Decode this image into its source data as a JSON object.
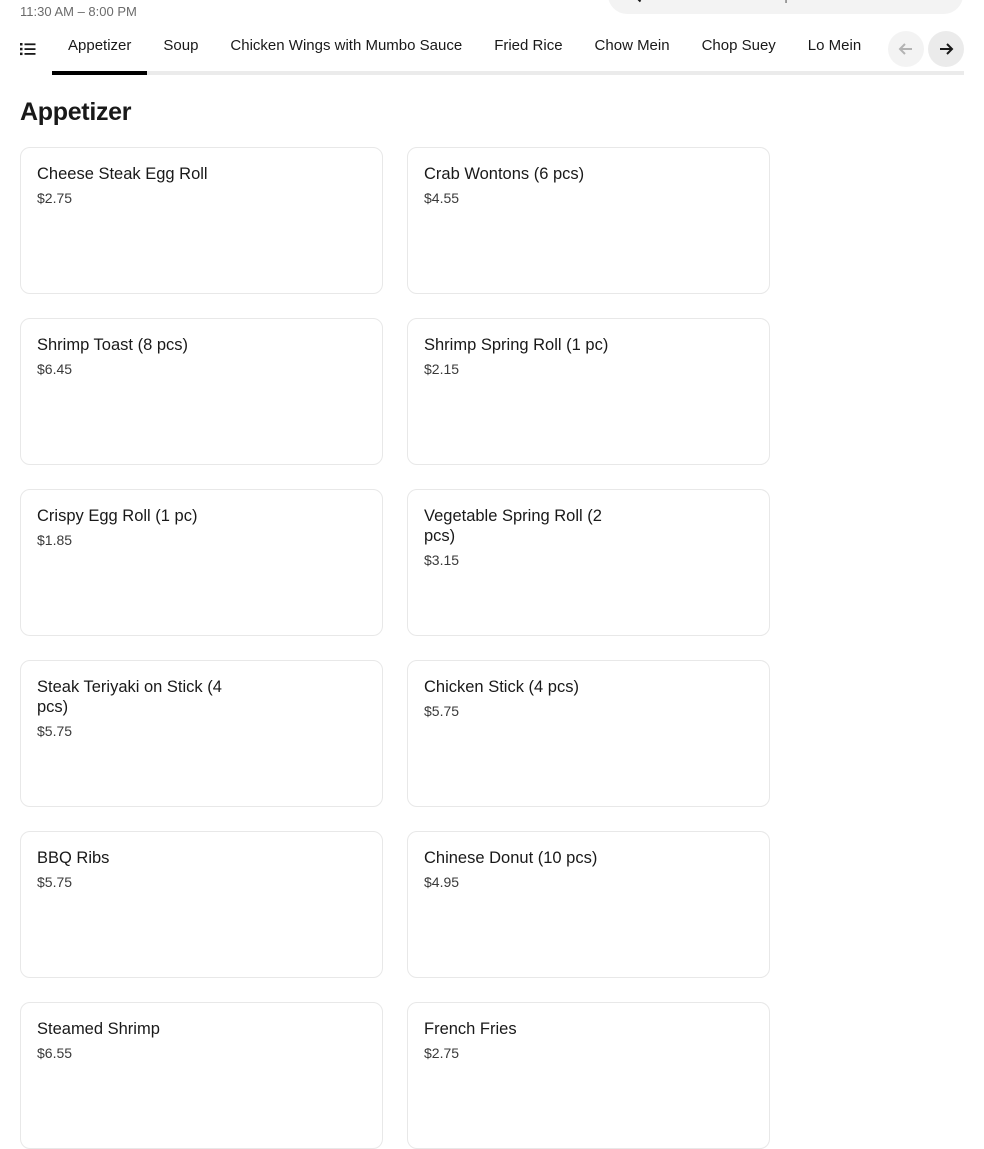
{
  "store": {
    "hours": "11:30 AM – 8:00 PM"
  },
  "search": {
    "placeholder": "Search in China Express"
  },
  "categories": {
    "tabs": [
      {
        "label": "Appetizer"
      },
      {
        "label": "Soup"
      },
      {
        "label": "Chicken Wings with Mumbo Sauce"
      },
      {
        "label": "Fried Rice"
      },
      {
        "label": "Chow Mein"
      },
      {
        "label": "Chop Suey"
      },
      {
        "label": "Lo Mein"
      }
    ],
    "active_index": 0
  },
  "section": {
    "title": "Appetizer",
    "items": [
      {
        "name": "Cheese Steak Egg Roll",
        "price": "$2.75"
      },
      {
        "name": "Crab Wontons (6 pcs)",
        "price": "$4.55"
      },
      {
        "name": "Shrimp Toast (8 pcs)",
        "price": "$6.45"
      },
      {
        "name": "Shrimp Spring Roll (1 pc)",
        "price": "$2.15"
      },
      {
        "name": "Crispy Egg Roll (1 pc)",
        "price": "$1.85"
      },
      {
        "name": "Vegetable Spring Roll (2 pcs)",
        "price": "$3.15"
      },
      {
        "name": "Steak Teriyaki on Stick (4 pcs)",
        "price": "$5.75"
      },
      {
        "name": "Chicken Stick (4 pcs)",
        "price": "$5.75"
      },
      {
        "name": "BBQ Ribs",
        "price": "$5.75"
      },
      {
        "name": "Chinese Donut (10 pcs)",
        "price": "$4.95"
      },
      {
        "name": "Steamed Shrimp",
        "price": "$6.55"
      },
      {
        "name": "French Fries",
        "price": "$2.75"
      }
    ]
  },
  "icons": {
    "search": "search-icon",
    "menu_list": "list-icon",
    "prev": "arrow-left-icon",
    "next": "arrow-right-icon"
  },
  "colors": {
    "text": "#191919",
    "muted": "#6b6b6b",
    "active_underline": "#000000"
  }
}
